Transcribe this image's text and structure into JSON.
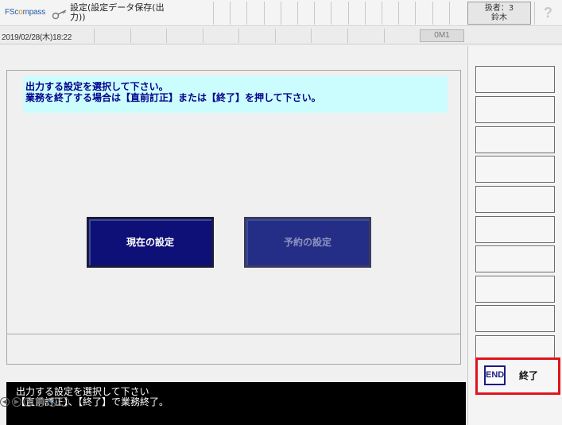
{
  "header": {
    "logo_text_1": "FSc",
    "logo_text_2": "o",
    "logo_text_3": "mpass",
    "title": "設定(設定データ保存(出\n力))",
    "operator_line1": "扱者：3",
    "operator_line2": "鈴木",
    "help_label": "?"
  },
  "datebar": {
    "datetime": "2019/02/28(木)18:22",
    "mode": "0M1"
  },
  "main": {
    "instruction_line1": "出力する設定を選択して下さい。",
    "instruction_line2": "業務を終了する場合は【直前訂正】または【終了】を押して下さい。",
    "current_settings_button": "現在の設定",
    "reserved_settings_button": "予約の設定"
  },
  "message_bar": {
    "line1": "出力する設定を選択して下さい",
    "line2": "【直前訂正】、【終了】で業務終了。"
  },
  "control_icons": [
    "◀",
    "▶",
    "✎",
    "▦",
    "🔍",
    "−"
  ],
  "side_panel": {
    "function_keys_count": 10,
    "end_badge": "END",
    "end_label": "終了"
  },
  "colors": {
    "instruction_bg": "#ccfdfe",
    "instruction_text": "#00008b",
    "button_navy": "#0e1078",
    "highlight_red": "#e0141c"
  }
}
